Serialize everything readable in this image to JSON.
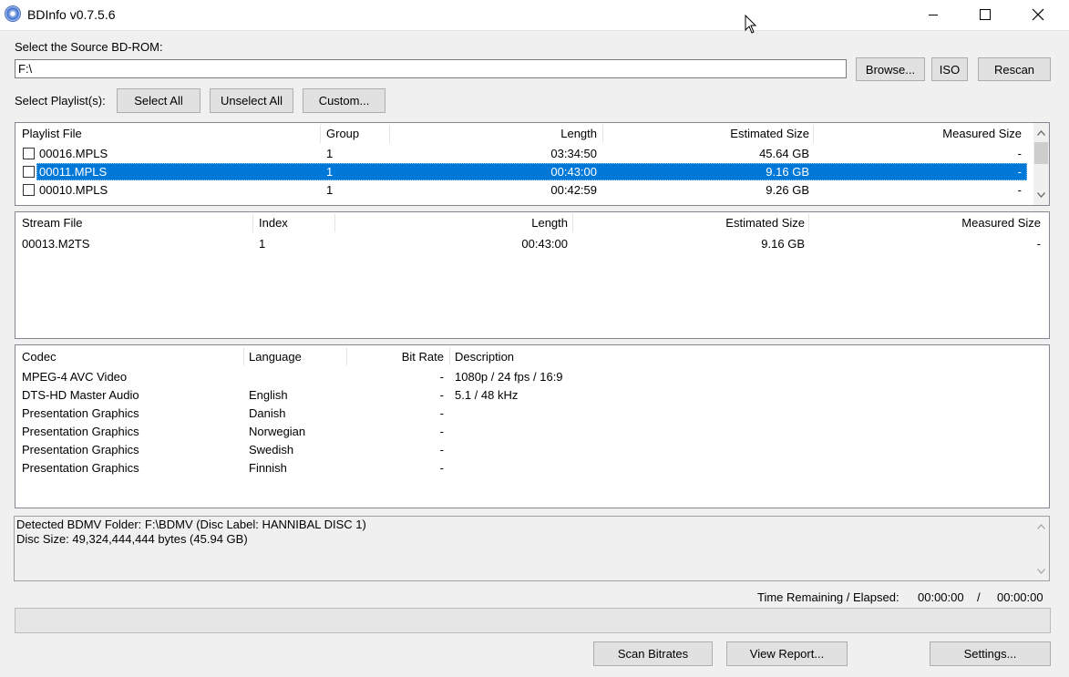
{
  "window": {
    "title": "BDInfo v0.7.5.6"
  },
  "source": {
    "label": "Select the Source BD-ROM:",
    "path": "F:\\",
    "browse_label": "Browse...",
    "iso_label": "ISO",
    "rescan_label": "Rescan"
  },
  "playlist_controls": {
    "label": "Select Playlist(s):",
    "select_all": "Select All",
    "unselect_all": "Unselect All",
    "custom": "Custom..."
  },
  "playlists": {
    "headers": {
      "file": "Playlist File",
      "group": "Group",
      "length": "Length",
      "estimated": "Estimated Size",
      "measured": "Measured Size"
    },
    "rows": [
      {
        "file": "00016.MPLS",
        "group": "1",
        "length": "03:34:50",
        "estimated": "45.64 GB",
        "measured": "-",
        "selected": false
      },
      {
        "file": "00011.MPLS",
        "group": "1",
        "length": "00:43:00",
        "estimated": "9.16 GB",
        "measured": "-",
        "selected": true
      },
      {
        "file": "00010.MPLS",
        "group": "1",
        "length": "00:42:59",
        "estimated": "9.26 GB",
        "measured": "-",
        "selected": false
      }
    ]
  },
  "streams": {
    "headers": {
      "file": "Stream File",
      "index": "Index",
      "length": "Length",
      "estimated": "Estimated Size",
      "measured": "Measured Size"
    },
    "rows": [
      {
        "file": "00013.M2TS",
        "index": "1",
        "length": "00:43:00",
        "estimated": "9.16 GB",
        "measured": "-"
      }
    ]
  },
  "codecs": {
    "headers": {
      "codec": "Codec",
      "language": "Language",
      "bitrate": "Bit Rate",
      "description": "Description"
    },
    "rows": [
      {
        "codec": "MPEG-4 AVC Video",
        "language": "",
        "bitrate": "-",
        "description": "1080p / 24 fps / 16:9"
      },
      {
        "codec": "DTS-HD Master Audio",
        "language": "English",
        "bitrate": "-",
        "description": "5.1 / 48 kHz"
      },
      {
        "codec": "Presentation Graphics",
        "language": "Danish",
        "bitrate": "-",
        "description": ""
      },
      {
        "codec": "Presentation Graphics",
        "language": "Norwegian",
        "bitrate": "-",
        "description": ""
      },
      {
        "codec": "Presentation Graphics",
        "language": "Swedish",
        "bitrate": "-",
        "description": ""
      },
      {
        "codec": "Presentation Graphics",
        "language": "Finnish",
        "bitrate": "-",
        "description": ""
      }
    ]
  },
  "info": {
    "line1": "Detected BDMV Folder: F:\\BDMV (Disc Label: HANNIBAL DISC 1)",
    "line2": "Disc Size: 49,324,444,444 bytes (45.94 GB)"
  },
  "time": {
    "label": "Time Remaining / Elapsed:",
    "remaining": "00:00:00",
    "separator": "/",
    "elapsed": "00:00:00"
  },
  "progress": {
    "fraction": 0
  },
  "footer": {
    "scan_label": "Scan Bitrates",
    "report_label": "View Report...",
    "settings_label": "Settings..."
  },
  "colors": {
    "selection": "#0078d7",
    "button_face": "#e1e1e1",
    "window_bg": "#f0f0f0"
  }
}
